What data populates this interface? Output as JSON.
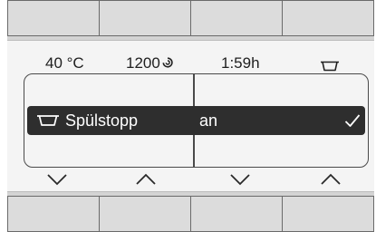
{
  "status_bar": {
    "temperature": "40 °C",
    "spin_speed": "1200",
    "spin_icon": "spin-icon",
    "duration": "1:59h",
    "tub_icon": "tub-icon"
  },
  "menu": {
    "selected_row": {
      "label": "Spülstopp",
      "value": "an",
      "icon": "tub-icon",
      "confirmed_icon": "checkmark-icon"
    }
  },
  "nav_arrows": [
    "chevron-down-icon",
    "chevron-up-icon",
    "chevron-down-icon",
    "chevron-up-icon"
  ],
  "colors": {
    "screen_bg": "#f4f4f4",
    "highlight_row": "#2e2e2e",
    "device_bg": "#d4d4d4"
  }
}
